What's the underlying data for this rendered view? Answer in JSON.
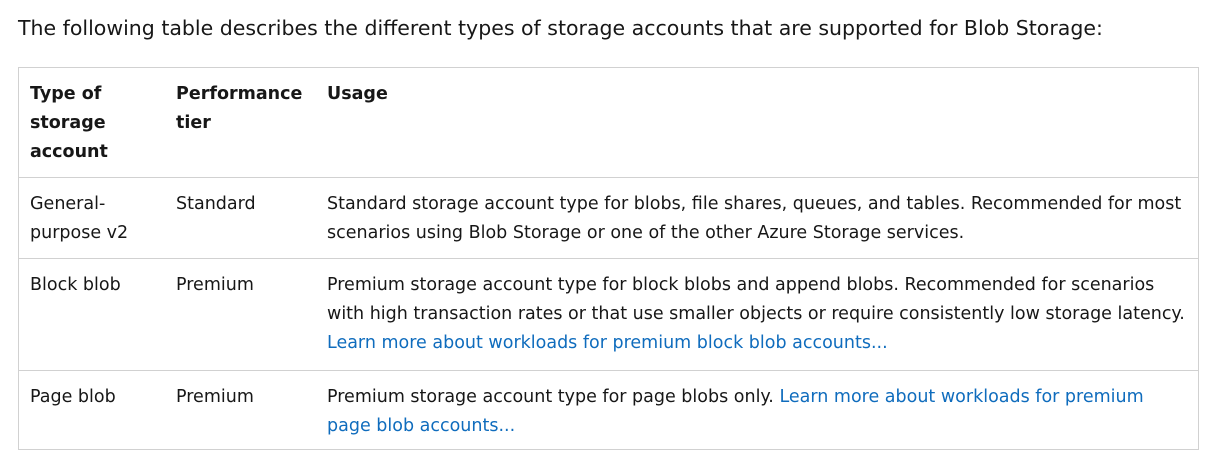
{
  "intro_text": "The following table describes the different types of storage accounts that are supported for Blob Storage:",
  "table": {
    "headers": {
      "type": "Type of storage account",
      "tier": "Performance tier",
      "usage": "Usage"
    },
    "rows": [
      {
        "type": "General-purpose v2",
        "tier": "Standard",
        "usage": "Standard storage account type for blobs, file shares, queues, and tables. Recommended for most scenarios using Blob Storage or one of the other Azure Storage services.",
        "link": ""
      },
      {
        "type": "Block blob",
        "tier": "Premium",
        "usage": "Premium storage account type for block blobs and append blobs. Recommended for scenarios with high transaction rates or that use smaller objects or require consistently low storage latency.",
        "link": "Learn more about workloads for premium block blob accounts..."
      },
      {
        "type": "Page blob",
        "tier": "Premium",
        "usage": "Premium storage account type for page blobs only.",
        "link": "Learn more about workloads for premium page blob accounts..."
      }
    ]
  },
  "colors": {
    "text": "#171717",
    "link": "#0f6cbd",
    "border": "#d1d1d1"
  }
}
